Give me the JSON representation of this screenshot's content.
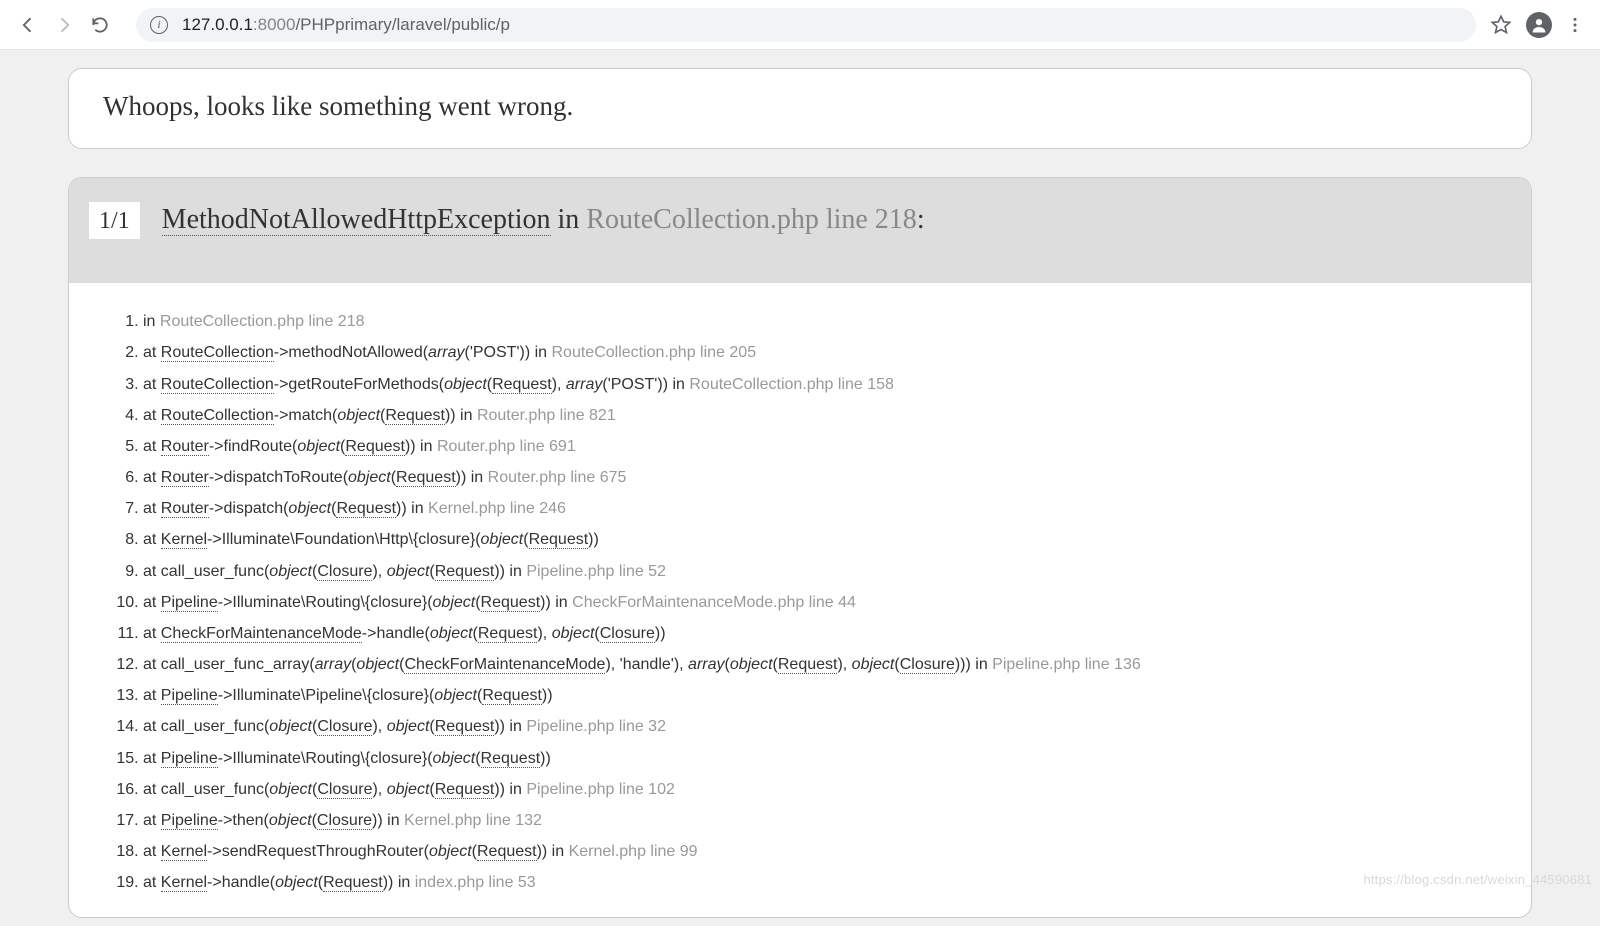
{
  "browser": {
    "url_host": "127.0.0.1",
    "url_port": ":8000",
    "url_path": "/PHPprimary/laravel/public/p"
  },
  "whoops": "Whoops, looks like something went wrong.",
  "exception": {
    "count": "1/1",
    "name": "MethodNotAllowedHttpException",
    "in_word": " in ",
    "location": "RouteCollection.php line 218",
    "colon": ":"
  },
  "trace": [
    {
      "parts": [
        {
          "t": "text",
          "v": "in "
        },
        {
          "t": "loc",
          "v": "RouteCollection.php line 218"
        }
      ]
    },
    {
      "parts": [
        {
          "t": "text",
          "v": "at "
        },
        {
          "t": "cls",
          "v": "RouteCollection"
        },
        {
          "t": "text",
          "v": "->methodNotAllowed("
        },
        {
          "t": "ital",
          "v": "array"
        },
        {
          "t": "text",
          "v": "('POST')) in "
        },
        {
          "t": "loc",
          "v": "RouteCollection.php line 205"
        }
      ]
    },
    {
      "parts": [
        {
          "t": "text",
          "v": "at "
        },
        {
          "t": "cls",
          "v": "RouteCollection"
        },
        {
          "t": "text",
          "v": "->getRouteForMethods("
        },
        {
          "t": "ital",
          "v": "object"
        },
        {
          "t": "text",
          "v": "("
        },
        {
          "t": "arg",
          "v": "Request"
        },
        {
          "t": "text",
          "v": "), "
        },
        {
          "t": "ital",
          "v": "array"
        },
        {
          "t": "text",
          "v": "('POST')) in "
        },
        {
          "t": "loc",
          "v": "RouteCollection.php line 158"
        }
      ]
    },
    {
      "parts": [
        {
          "t": "text",
          "v": "at "
        },
        {
          "t": "cls",
          "v": "RouteCollection"
        },
        {
          "t": "text",
          "v": "->match("
        },
        {
          "t": "ital",
          "v": "object"
        },
        {
          "t": "text",
          "v": "("
        },
        {
          "t": "arg",
          "v": "Request"
        },
        {
          "t": "text",
          "v": ")) in "
        },
        {
          "t": "loc",
          "v": "Router.php line 821"
        }
      ]
    },
    {
      "parts": [
        {
          "t": "text",
          "v": "at "
        },
        {
          "t": "cls",
          "v": "Router"
        },
        {
          "t": "text",
          "v": "->findRoute("
        },
        {
          "t": "ital",
          "v": "object"
        },
        {
          "t": "text",
          "v": "("
        },
        {
          "t": "arg",
          "v": "Request"
        },
        {
          "t": "text",
          "v": ")) in "
        },
        {
          "t": "loc",
          "v": "Router.php line 691"
        }
      ]
    },
    {
      "parts": [
        {
          "t": "text",
          "v": "at "
        },
        {
          "t": "cls",
          "v": "Router"
        },
        {
          "t": "text",
          "v": "->dispatchToRoute("
        },
        {
          "t": "ital",
          "v": "object"
        },
        {
          "t": "text",
          "v": "("
        },
        {
          "t": "arg",
          "v": "Request"
        },
        {
          "t": "text",
          "v": ")) in "
        },
        {
          "t": "loc",
          "v": "Router.php line 675"
        }
      ]
    },
    {
      "parts": [
        {
          "t": "text",
          "v": "at "
        },
        {
          "t": "cls",
          "v": "Router"
        },
        {
          "t": "text",
          "v": "->dispatch("
        },
        {
          "t": "ital",
          "v": "object"
        },
        {
          "t": "text",
          "v": "("
        },
        {
          "t": "arg",
          "v": "Request"
        },
        {
          "t": "text",
          "v": ")) in "
        },
        {
          "t": "loc",
          "v": "Kernel.php line 246"
        }
      ]
    },
    {
      "parts": [
        {
          "t": "text",
          "v": "at "
        },
        {
          "t": "cls",
          "v": "Kernel"
        },
        {
          "t": "text",
          "v": "->Illuminate\\Foundation\\Http\\{closure}("
        },
        {
          "t": "ital",
          "v": "object"
        },
        {
          "t": "text",
          "v": "("
        },
        {
          "t": "arg",
          "v": "Request"
        },
        {
          "t": "text",
          "v": "))"
        }
      ]
    },
    {
      "parts": [
        {
          "t": "text",
          "v": "at call_user_func("
        },
        {
          "t": "ital",
          "v": "object"
        },
        {
          "t": "text",
          "v": "("
        },
        {
          "t": "arg",
          "v": "Closure"
        },
        {
          "t": "text",
          "v": "), "
        },
        {
          "t": "ital",
          "v": "object"
        },
        {
          "t": "text",
          "v": "("
        },
        {
          "t": "arg",
          "v": "Request"
        },
        {
          "t": "text",
          "v": ")) in "
        },
        {
          "t": "loc",
          "v": "Pipeline.php line 52"
        }
      ]
    },
    {
      "parts": [
        {
          "t": "text",
          "v": "at "
        },
        {
          "t": "cls",
          "v": "Pipeline"
        },
        {
          "t": "text",
          "v": "->Illuminate\\Routing\\{closure}("
        },
        {
          "t": "ital",
          "v": "object"
        },
        {
          "t": "text",
          "v": "("
        },
        {
          "t": "arg",
          "v": "Request"
        },
        {
          "t": "text",
          "v": ")) in "
        },
        {
          "t": "loc",
          "v": "CheckForMaintenanceMode.php line 44"
        }
      ]
    },
    {
      "parts": [
        {
          "t": "text",
          "v": "at "
        },
        {
          "t": "cls",
          "v": "CheckForMaintenanceMode"
        },
        {
          "t": "text",
          "v": "->handle("
        },
        {
          "t": "ital",
          "v": "object"
        },
        {
          "t": "text",
          "v": "("
        },
        {
          "t": "arg",
          "v": "Request"
        },
        {
          "t": "text",
          "v": "), "
        },
        {
          "t": "ital",
          "v": "object"
        },
        {
          "t": "text",
          "v": "("
        },
        {
          "t": "arg",
          "v": "Closure"
        },
        {
          "t": "text",
          "v": "))"
        }
      ]
    },
    {
      "parts": [
        {
          "t": "text",
          "v": "at call_user_func_array("
        },
        {
          "t": "ital",
          "v": "array"
        },
        {
          "t": "text",
          "v": "("
        },
        {
          "t": "ital",
          "v": "object"
        },
        {
          "t": "text",
          "v": "("
        },
        {
          "t": "arg",
          "v": "CheckForMaintenanceMode"
        },
        {
          "t": "text",
          "v": "), 'handle'), "
        },
        {
          "t": "ital",
          "v": "array"
        },
        {
          "t": "text",
          "v": "("
        },
        {
          "t": "ital",
          "v": "object"
        },
        {
          "t": "text",
          "v": "("
        },
        {
          "t": "arg",
          "v": "Request"
        },
        {
          "t": "text",
          "v": "), "
        },
        {
          "t": "ital",
          "v": "object"
        },
        {
          "t": "text",
          "v": "("
        },
        {
          "t": "arg",
          "v": "Closure"
        },
        {
          "t": "text",
          "v": "))) in "
        },
        {
          "t": "loc",
          "v": "Pipeline.php line 136"
        }
      ]
    },
    {
      "parts": [
        {
          "t": "text",
          "v": "at "
        },
        {
          "t": "cls",
          "v": "Pipeline"
        },
        {
          "t": "text",
          "v": "->Illuminate\\Pipeline\\{closure}("
        },
        {
          "t": "ital",
          "v": "object"
        },
        {
          "t": "text",
          "v": "("
        },
        {
          "t": "arg",
          "v": "Request"
        },
        {
          "t": "text",
          "v": "))"
        }
      ]
    },
    {
      "parts": [
        {
          "t": "text",
          "v": "at call_user_func("
        },
        {
          "t": "ital",
          "v": "object"
        },
        {
          "t": "text",
          "v": "("
        },
        {
          "t": "arg",
          "v": "Closure"
        },
        {
          "t": "text",
          "v": "), "
        },
        {
          "t": "ital",
          "v": "object"
        },
        {
          "t": "text",
          "v": "("
        },
        {
          "t": "arg",
          "v": "Request"
        },
        {
          "t": "text",
          "v": ")) in "
        },
        {
          "t": "loc",
          "v": "Pipeline.php line 32"
        }
      ]
    },
    {
      "parts": [
        {
          "t": "text",
          "v": "at "
        },
        {
          "t": "cls",
          "v": "Pipeline"
        },
        {
          "t": "text",
          "v": "->Illuminate\\Routing\\{closure}("
        },
        {
          "t": "ital",
          "v": "object"
        },
        {
          "t": "text",
          "v": "("
        },
        {
          "t": "arg",
          "v": "Request"
        },
        {
          "t": "text",
          "v": "))"
        }
      ]
    },
    {
      "parts": [
        {
          "t": "text",
          "v": "at call_user_func("
        },
        {
          "t": "ital",
          "v": "object"
        },
        {
          "t": "text",
          "v": "("
        },
        {
          "t": "arg",
          "v": "Closure"
        },
        {
          "t": "text",
          "v": "), "
        },
        {
          "t": "ital",
          "v": "object"
        },
        {
          "t": "text",
          "v": "("
        },
        {
          "t": "arg",
          "v": "Request"
        },
        {
          "t": "text",
          "v": ")) in "
        },
        {
          "t": "loc",
          "v": "Pipeline.php line 102"
        }
      ]
    },
    {
      "parts": [
        {
          "t": "text",
          "v": "at "
        },
        {
          "t": "cls",
          "v": "Pipeline"
        },
        {
          "t": "text",
          "v": "->then("
        },
        {
          "t": "ital",
          "v": "object"
        },
        {
          "t": "text",
          "v": "("
        },
        {
          "t": "arg",
          "v": "Closure"
        },
        {
          "t": "text",
          "v": ")) in "
        },
        {
          "t": "loc",
          "v": "Kernel.php line 132"
        }
      ]
    },
    {
      "parts": [
        {
          "t": "text",
          "v": "at "
        },
        {
          "t": "cls",
          "v": "Kernel"
        },
        {
          "t": "text",
          "v": "->sendRequestThroughRouter("
        },
        {
          "t": "ital",
          "v": "object"
        },
        {
          "t": "text",
          "v": "("
        },
        {
          "t": "arg",
          "v": "Request"
        },
        {
          "t": "text",
          "v": ")) in "
        },
        {
          "t": "loc",
          "v": "Kernel.php line 99"
        }
      ]
    },
    {
      "parts": [
        {
          "t": "text",
          "v": "at "
        },
        {
          "t": "cls",
          "v": "Kernel"
        },
        {
          "t": "text",
          "v": "->handle("
        },
        {
          "t": "ital",
          "v": "object"
        },
        {
          "t": "text",
          "v": "("
        },
        {
          "t": "arg",
          "v": "Request"
        },
        {
          "t": "text",
          "v": ")) in "
        },
        {
          "t": "loc",
          "v": "index.php line 53"
        }
      ]
    }
  ],
  "watermark": "https://blog.csdn.net/weixin_44590681"
}
